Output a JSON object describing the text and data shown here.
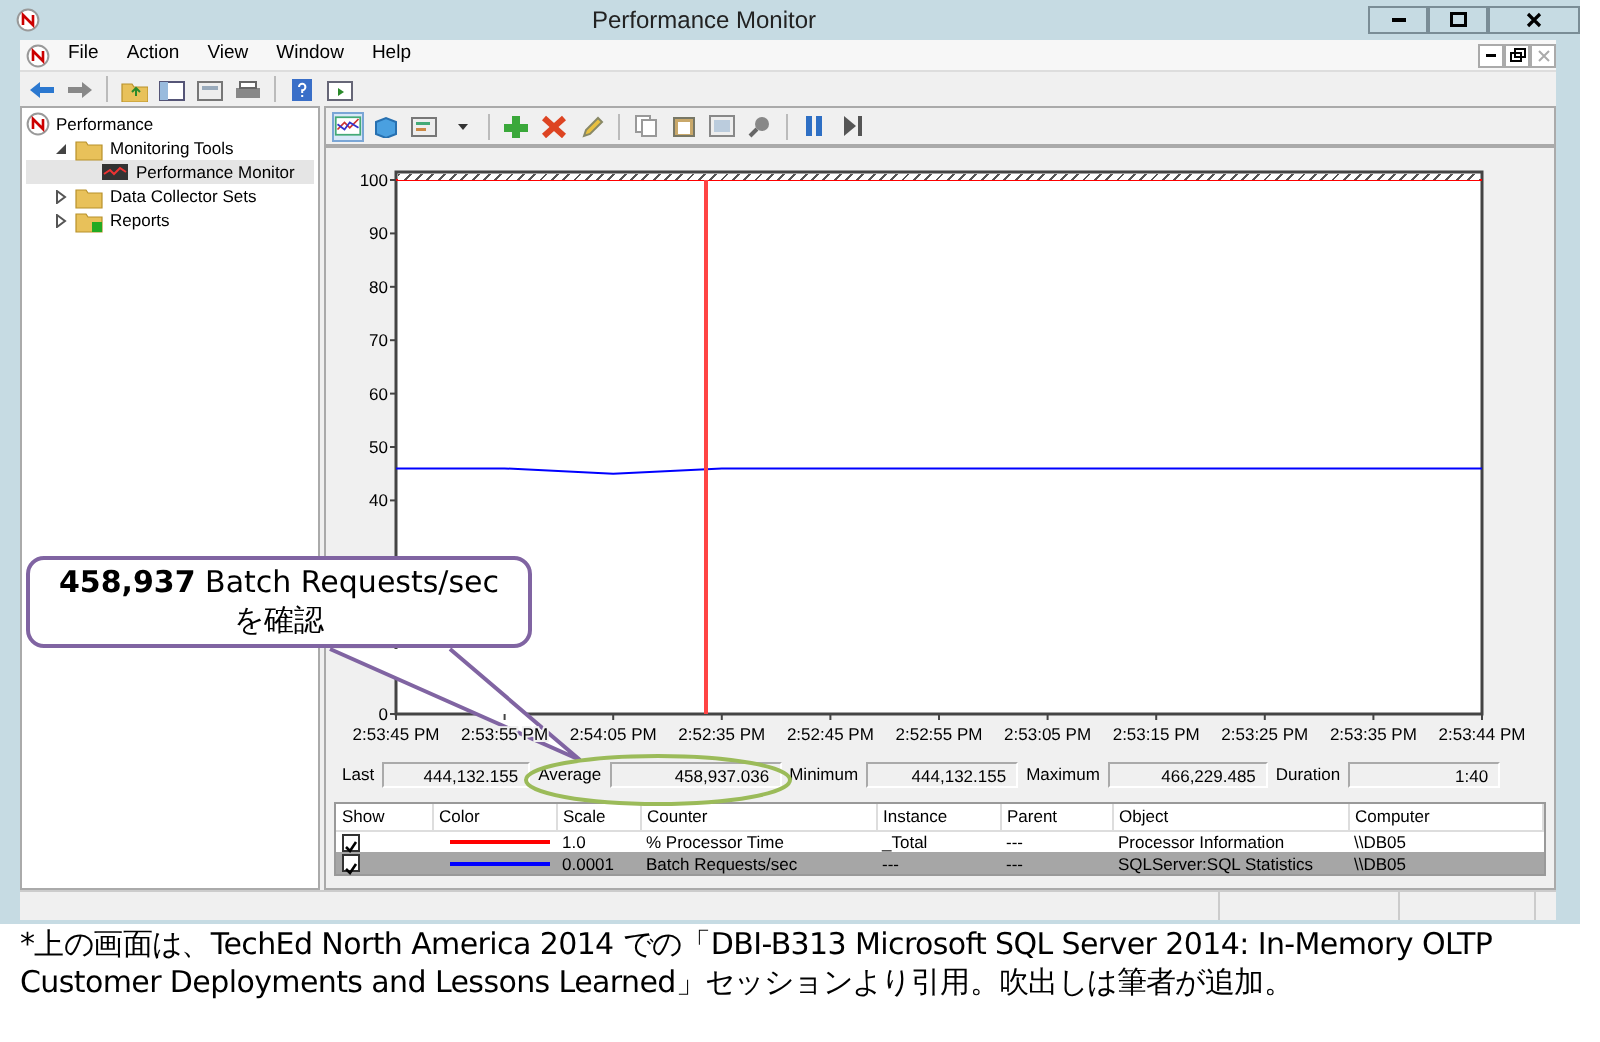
{
  "window": {
    "title": "Performance Monitor"
  },
  "menu": [
    "File",
    "Action",
    "View",
    "Window",
    "Help"
  ],
  "tree": [
    {
      "label": "Performance",
      "selected": false,
      "children": [
        {
          "label": "Monitoring Tools",
          "selected": false,
          "expanded": true,
          "children": [
            {
              "label": "Performance Monitor",
              "selected": true
            }
          ]
        },
        {
          "label": "Data Collector Sets",
          "selected": false,
          "expanded": false
        },
        {
          "label": "Reports",
          "selected": false,
          "expanded": false
        }
      ]
    }
  ],
  "graph": {
    "chart_data": {
      "type": "line",
      "categories": [
        "2:53:45 PM",
        "2:53:55 PM",
        "2:54:05 PM",
        "2:52:35 PM",
        "2:52:45 PM",
        "2:52:55 PM",
        "2:53:05 PM",
        "2:53:15 PM",
        "2:53:25 PM",
        "2:53:35 PM",
        "2:53:44 PM"
      ],
      "ylim": [
        0,
        101.5
      ],
      "yticks": [
        0,
        40,
        50,
        60,
        70,
        80,
        90,
        100
      ],
      "series": [
        {
          "name": "% Processor Time",
          "color": "#ff0000",
          "values": [
            100,
            100,
            100,
            100,
            100,
            100,
            100,
            100,
            100,
            100,
            100
          ]
        },
        {
          "name": "Batch Requests/sec",
          "color": "#0000ff",
          "values": [
            46,
            46,
            45,
            46,
            46,
            46,
            46,
            46,
            46,
            46,
            46
          ]
        }
      ]
    }
  },
  "stats": [
    {
      "label": "Last",
      "value": "444,132.155"
    },
    {
      "label": "Average",
      "value": "458,937.036"
    },
    {
      "label": "Minimum",
      "value": "444,132.155"
    },
    {
      "label": "Maximum",
      "value": "466,229.485"
    },
    {
      "label": "Duration",
      "value": "1:40"
    }
  ],
  "legend": {
    "columns": [
      "Show",
      "Color",
      "Scale",
      "Counter",
      "Instance",
      "Parent",
      "Object",
      "Computer"
    ],
    "rows": [
      {
        "checked": true,
        "color": "#ff0000",
        "selected": false,
        "scale": "1.0",
        "instance": "_Total",
        "parent": "---",
        "object": "Processor Information",
        "computer": "\\\\DB05"
      },
      {
        "checked": true,
        "color": "#0000ff",
        "selected": true,
        "scale": "0.0001",
        "instance": "---",
        "parent": "---",
        "object": "SQLServer:SQL Statistics",
        "computer": "\\\\DB05"
      }
    ]
  },
  "callout": {
    "lines": [
      "**458,937** Batch Requests/sec",
      "を確認"
    ]
  },
  "caption": "*上の画面は、TechEd North America 2014 での「DBI-B313 Microsoft SQL Server 2014: In-Memory OLTP Customer Deployments and Lessons Learned」セッションより引用。吹出しは筆者が追加。"
}
